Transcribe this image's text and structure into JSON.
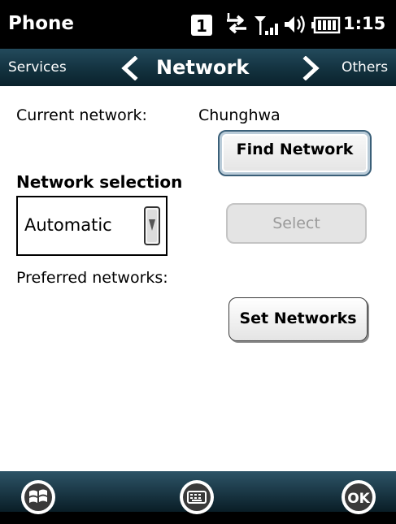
{
  "statusbar": {
    "app_title": "Phone",
    "sim_badge": "1",
    "clock": "1:15",
    "icons": [
      "sim-1-icon",
      "data-sync-icon",
      "signal-strength-icon",
      "volume-icon",
      "battery-icon"
    ]
  },
  "tabs": {
    "previous": "Services",
    "current": "Network",
    "next": "Others"
  },
  "content": {
    "current_network_label": "Current network:",
    "current_network_value": "Chunghwa",
    "find_network_button": "Find Network",
    "network_selection_heading": "Network selection",
    "network_mode": {
      "selected": "Automatic",
      "options": [
        "Automatic"
      ]
    },
    "select_button": "Select",
    "select_button_enabled": false,
    "preferred_networks_label": "Preferred networks:",
    "set_networks_button": "Set Networks"
  },
  "softkeys": {
    "left_icon": "windows-start-icon",
    "center_icon": "keyboard-icon",
    "right_label": "OK"
  },
  "colors": {
    "statusbar_bg": "#000000",
    "tabbar_bg": "#13323f",
    "focus_border": "#3a5f78",
    "disabled_text": "#9a9a9a"
  }
}
